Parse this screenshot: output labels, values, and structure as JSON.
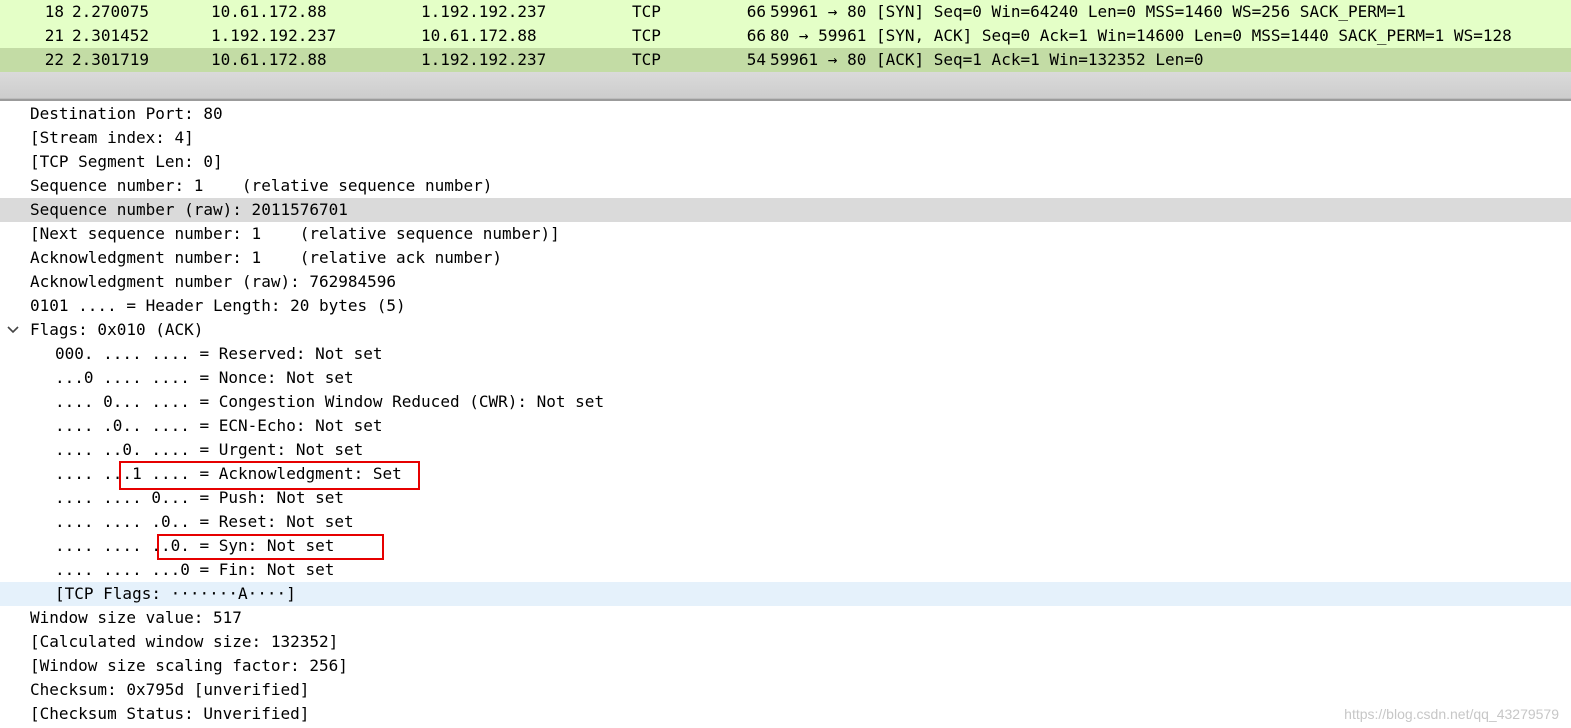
{
  "packet_list": {
    "rows": [
      {
        "no": "18",
        "time": "2.270075",
        "source": "10.61.172.88",
        "destination": "1.192.192.237",
        "protocol": "TCP",
        "length": "66",
        "info": "59961 → 80 [SYN] Seq=0 Win=64240 Len=0 MSS=1460 WS=256 SACK_PERM=1",
        "selected": false
      },
      {
        "no": "21",
        "time": "2.301452",
        "source": "1.192.192.237",
        "destination": "10.61.172.88",
        "protocol": "TCP",
        "length": "66",
        "info": "80 → 59961 [SYN, ACK] Seq=0 Ack=1 Win=14600 Len=0 MSS=1440 SACK_PERM=1 WS=128",
        "selected": false
      },
      {
        "no": "22",
        "time": "2.301719",
        "source": "10.61.172.88",
        "destination": "1.192.192.237",
        "protocol": "TCP",
        "length": "54",
        "info": "59961 → 80 [ACK] Seq=1 Ack=1 Win=132352 Len=0",
        "selected": true
      }
    ]
  },
  "details": {
    "lines": [
      {
        "text": "Destination Port: 80",
        "level": 0
      },
      {
        "text": "[Stream index: 4]",
        "level": 0
      },
      {
        "text": "[TCP Segment Len: 0]",
        "level": 0
      },
      {
        "text": "Sequence number: 1    (relative sequence number)",
        "level": 0
      },
      {
        "text": "Sequence number (raw): 2011576701",
        "level": 0,
        "state": "selected"
      },
      {
        "text": "[Next sequence number: 1    (relative sequence number)]",
        "level": 0
      },
      {
        "text": "Acknowledgment number: 1    (relative ack number)",
        "level": 0
      },
      {
        "text": "Acknowledgment number (raw): 762984596",
        "level": 0
      },
      {
        "text": "0101 .... = Header Length: 20 bytes (5)",
        "level": 0
      },
      {
        "text": "Flags: 0x010 (ACK)",
        "level": 0,
        "expander": "chevron-down-icon"
      },
      {
        "text": "000. .... .... = Reserved: Not set",
        "level": 1
      },
      {
        "text": "...0 .... .... = Nonce: Not set",
        "level": 1
      },
      {
        "text": ".... 0... .... = Congestion Window Reduced (CWR): Not set",
        "level": 1
      },
      {
        "text": ".... .0.. .... = ECN-Echo: Not set",
        "level": 1
      },
      {
        "text": ".... ..0. .... = Urgent: Not set",
        "level": 1
      },
      {
        "text": ".... ...1 .... = Acknowledgment: Set",
        "level": 1
      },
      {
        "text": ".... .... 0... = Push: Not set",
        "level": 1
      },
      {
        "text": ".... .... .0.. = Reset: Not set",
        "level": 1
      },
      {
        "text": ".... .... ..0. = Syn: Not set",
        "level": 1
      },
      {
        "text": ".... .... ...0 = Fin: Not set",
        "level": 1
      },
      {
        "text": "[TCP Flags: ·······A····]",
        "level": 1,
        "state": "hover"
      },
      {
        "text": "Window size value: 517",
        "level": 0
      },
      {
        "text": "[Calculated window size: 132352]",
        "level": 0
      },
      {
        "text": "[Window size scaling factor: 256]",
        "level": 0
      },
      {
        "text": "Checksum: 0x795d [unverified]",
        "level": 0
      },
      {
        "text": "[Checksum Status: Unverified]",
        "level": 0
      }
    ]
  },
  "annotation_color": "#e60000",
  "watermark": "https://blog.csdn.net/qq_43279579"
}
